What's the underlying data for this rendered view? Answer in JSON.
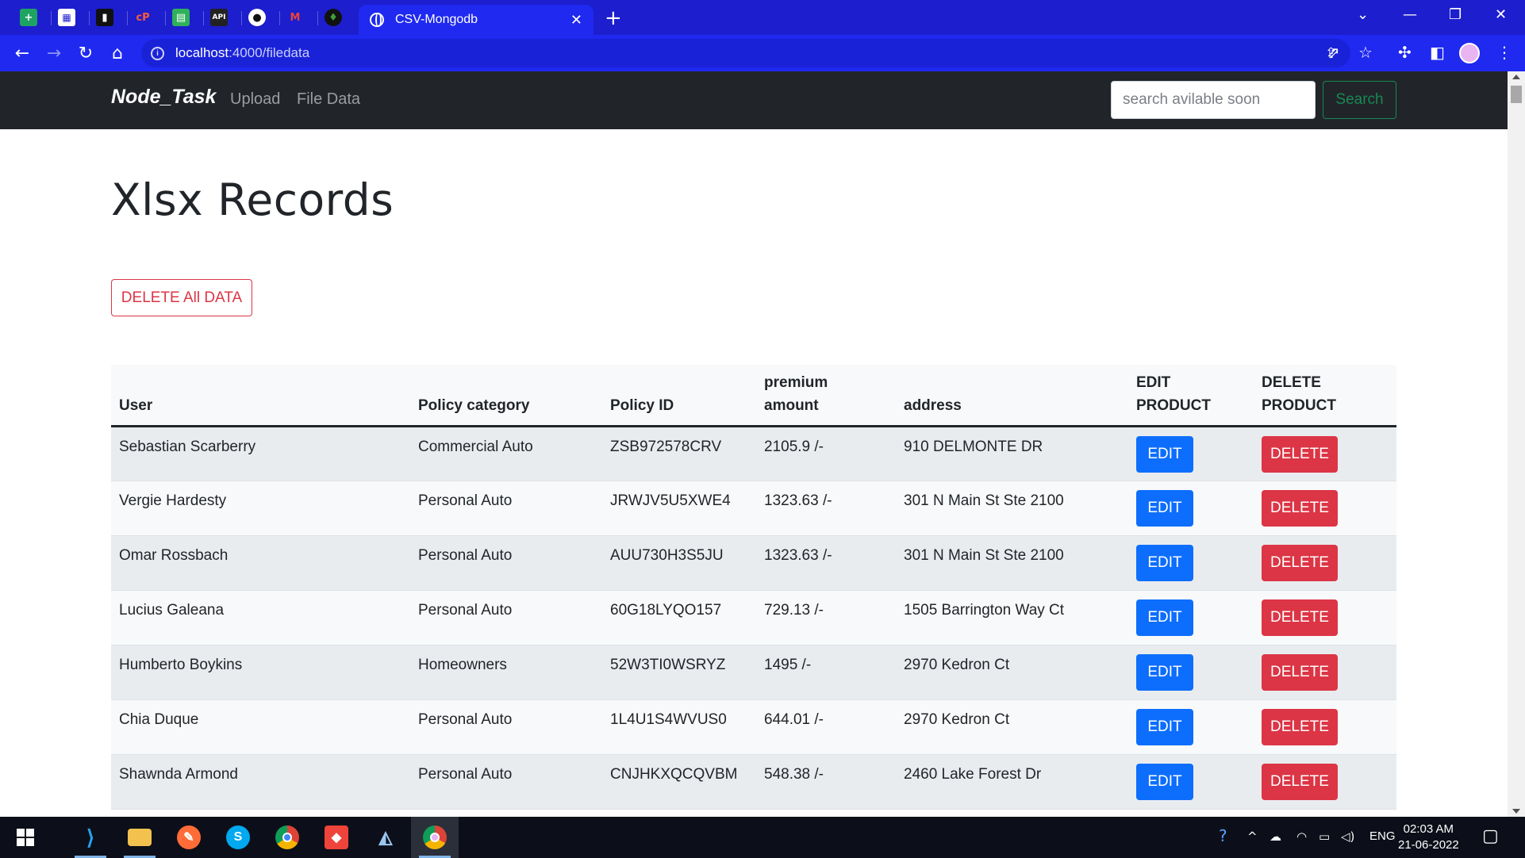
{
  "browser": {
    "active_tab_title": "CSV-Mongodb",
    "url_host": "localhost",
    "url_path": ":4000/filedata"
  },
  "navbar": {
    "brand": "Node_Task",
    "links": [
      "Upload",
      "File Data"
    ],
    "search_placeholder": "search avilable soon",
    "search_button": "Search"
  },
  "page": {
    "heading": "Xlsx Records",
    "delete_all_label": "DELETE All DATA"
  },
  "table": {
    "headers": {
      "user": "User",
      "policy_category": "Policy category",
      "policy_id": "Policy ID",
      "premium_line1": "premium",
      "premium_line2": "amount",
      "address": "address",
      "edit_line1": "EDIT",
      "edit_line2": "PRODUCT",
      "delete_line1": "DELETE",
      "delete_line2": "PRODUCT"
    },
    "edit_label": "EDIT",
    "delete_label": "DELETE",
    "rows": [
      {
        "user": "Sebastian Scarberry",
        "category": "Commercial Auto",
        "policy_id": "ZSB972578CRV",
        "premium": "2105.9 /-",
        "address": "910 DELMONTE DR"
      },
      {
        "user": "Vergie Hardesty",
        "category": "Personal Auto",
        "policy_id": "JRWJV5U5XWE4",
        "premium": "1323.63 /-",
        "address": "301 N Main St Ste 2100"
      },
      {
        "user": "Omar Rossbach",
        "category": "Personal Auto",
        "policy_id": "AUU730H3S5JU",
        "premium": "1323.63 /-",
        "address": "301 N Main St Ste 2100"
      },
      {
        "user": "Lucius Galeana",
        "category": "Personal Auto",
        "policy_id": "60G18LYQO157",
        "premium": "729.13 /-",
        "address": "1505 Barrington Way Ct"
      },
      {
        "user": "Humberto Boykins",
        "category": "Homeowners",
        "policy_id": "52W3TI0WSRYZ",
        "premium": "1495 /-",
        "address": "2970 Kedron Ct"
      },
      {
        "user": "Chia Duque",
        "category": "Personal Auto",
        "policy_id": "1L4U1S4WVUS0",
        "premium": "644.01 /-",
        "address": "2970 Kedron Ct"
      },
      {
        "user": "Shawnda Armond",
        "category": "Personal Auto",
        "policy_id": "CNJHKXQCQVBM",
        "premium": "548.38 /-",
        "address": "2460 Lake Forest Dr"
      }
    ]
  },
  "taskbar": {
    "language": "ENG",
    "time": "02:03 AM",
    "date": "21-06-2022"
  },
  "colors": {
    "tab_strip": "#1d1ecd",
    "toolbar": "#1f29f0",
    "navbar": "#212529",
    "primary": "#0d6efd",
    "danger": "#dc3545",
    "success": "#198754"
  }
}
